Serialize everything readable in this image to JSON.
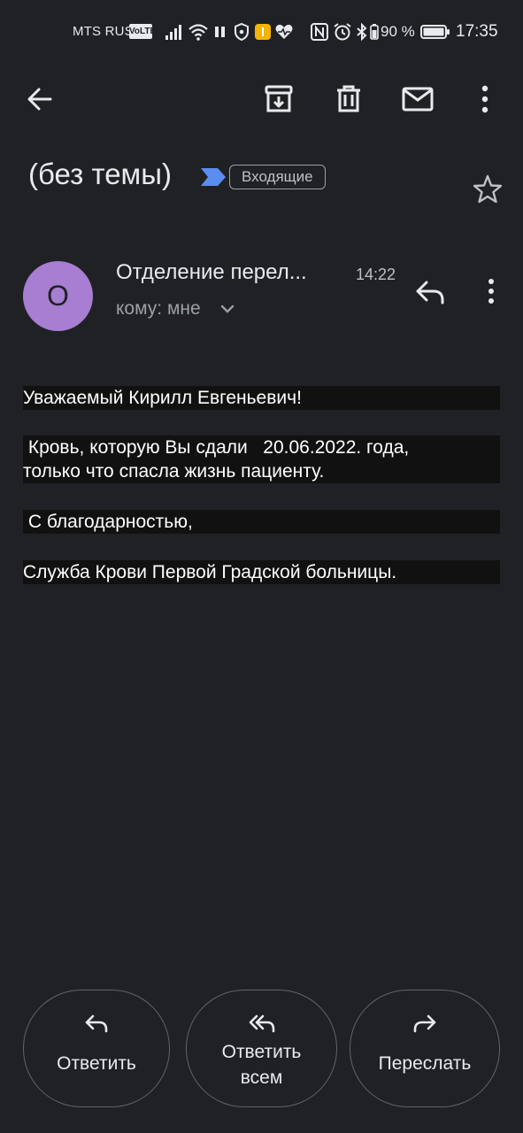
{
  "status_bar": {
    "carrier": "MTS RUS",
    "volte": "VoLTE",
    "battery": "90 %",
    "time": "17:35"
  },
  "toolbar": {
    "back": "back-arrow-icon",
    "archive": "archive-icon",
    "delete": "trash-icon",
    "mark_unread": "mail-icon",
    "more": "more-vert-icon"
  },
  "email": {
    "subject": "(без темы)",
    "label": "Входящие",
    "avatar_letter": "О",
    "avatar_color": "#a77ed2",
    "sender": "Отделение перел...",
    "time": "14:22",
    "recipient": "кому: мне",
    "body": [
      "Уважаемый Кирилл Евгеньевич!",
      " Кровь, которую Вы сдали   20.06.2022. года,",
      "только что спасла жизнь пациенту.",
      " С благодарностью,",
      "Служба Крови Первой Градской больницы."
    ]
  },
  "actions": {
    "reply": "Ответить",
    "reply_all_1": "Ответить",
    "reply_all_2": "всем",
    "forward": "Переслать"
  },
  "colors": {
    "background": "#202124",
    "importance": "#5b8def",
    "body_highlight": "#111111"
  }
}
